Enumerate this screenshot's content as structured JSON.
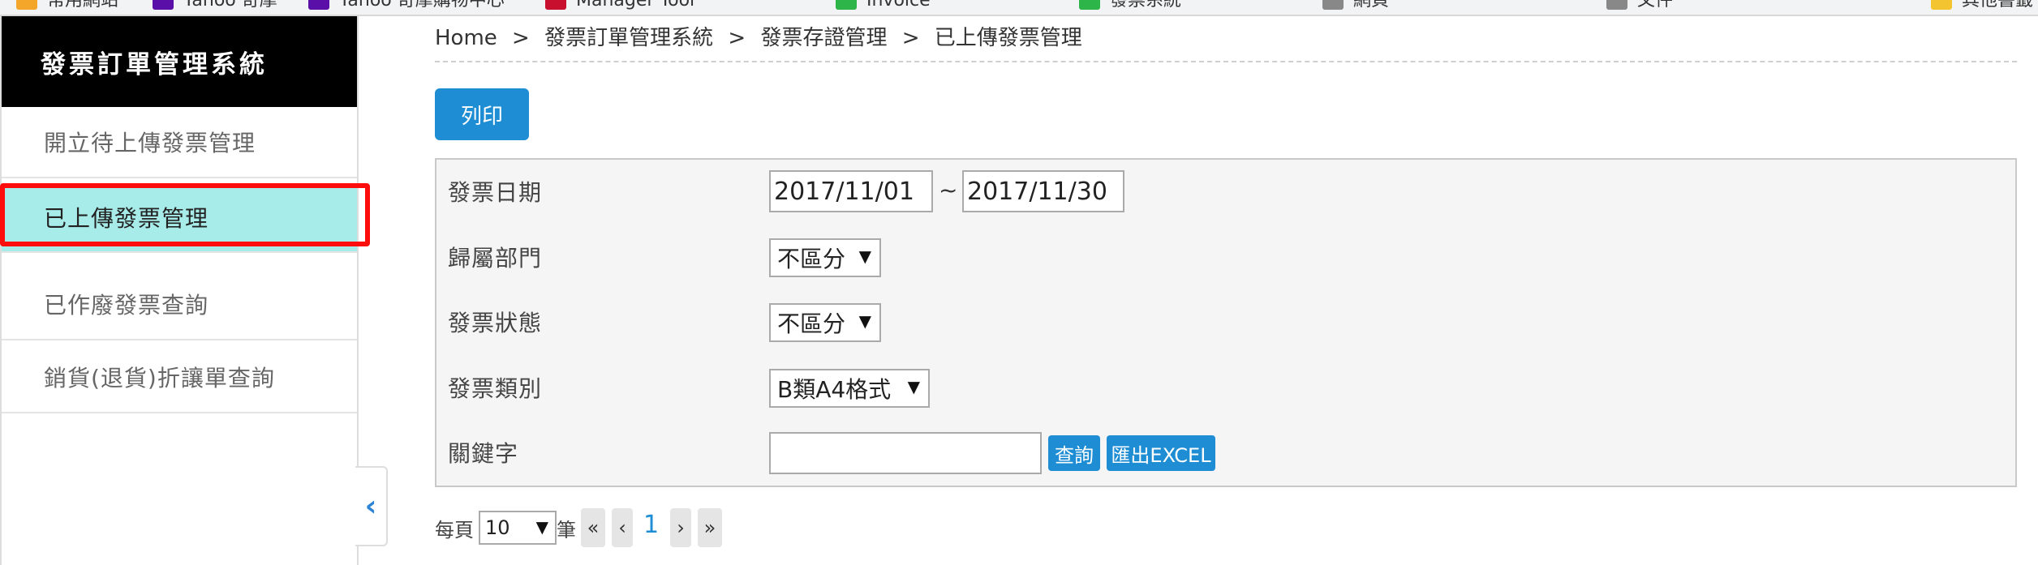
{
  "bookmarks": [
    {
      "label": "常用網站",
      "color": "#f4a62a"
    },
    {
      "label": "Yahoo 奇摩",
      "color": "#5a0fa8"
    },
    {
      "label": "Yahoo 奇摩購物中心",
      "color": "#5a0fa8"
    },
    {
      "label": "Manager Tool",
      "color": "#c8102e"
    },
    {
      "label": "Invoice",
      "color": "#2db54a"
    },
    {
      "label": "發票系統",
      "color": "#2db54a"
    },
    {
      "label": "網頁",
      "color": "#888888"
    },
    {
      "label": "文件",
      "color": "#888888"
    },
    {
      "label": "其他書籤",
      "color": "#f4c430"
    }
  ],
  "sidebar": {
    "brand": "發票訂單管理系統",
    "items": [
      {
        "label": "開立待上傳發票管理"
      },
      {
        "label": "已上傳發票管理"
      },
      {
        "label": "已作廢發票查詢"
      },
      {
        "label": "銷貨(退貨)折讓單查詢"
      }
    ],
    "collapse_icon": "chevron-left-icon"
  },
  "breadcrumb": {
    "items": [
      "Home",
      "發票訂單管理系統",
      "發票存證管理",
      "已上傳發票管理"
    ],
    "separator": ">"
  },
  "toolbar": {
    "print_label": "列印"
  },
  "filters": {
    "invoice_date_label": "發票日期",
    "date_from": "2017/11/01",
    "date_separator": "~",
    "date_to": "2017/11/30",
    "department_label": "歸屬部門",
    "department_value": "不區分",
    "status_label": "發票狀態",
    "status_value": "不區分",
    "type_label": "發票類別",
    "type_value": "B類A4格式",
    "keyword_label": "關鍵字",
    "keyword_value": "",
    "search_label": "查詢",
    "export_label": "匯出EXCEL"
  },
  "pagination": {
    "per_page_label": "每頁",
    "per_page_value": "10",
    "unit_label": "筆",
    "first": "«",
    "prev": "‹",
    "current": "1",
    "next": "›",
    "last": "»"
  },
  "colors": {
    "brand_bg": "#000000",
    "active_item": "#a8ece9",
    "highlight": "#ff0d0d",
    "primary_button": "#1e8dd3"
  }
}
